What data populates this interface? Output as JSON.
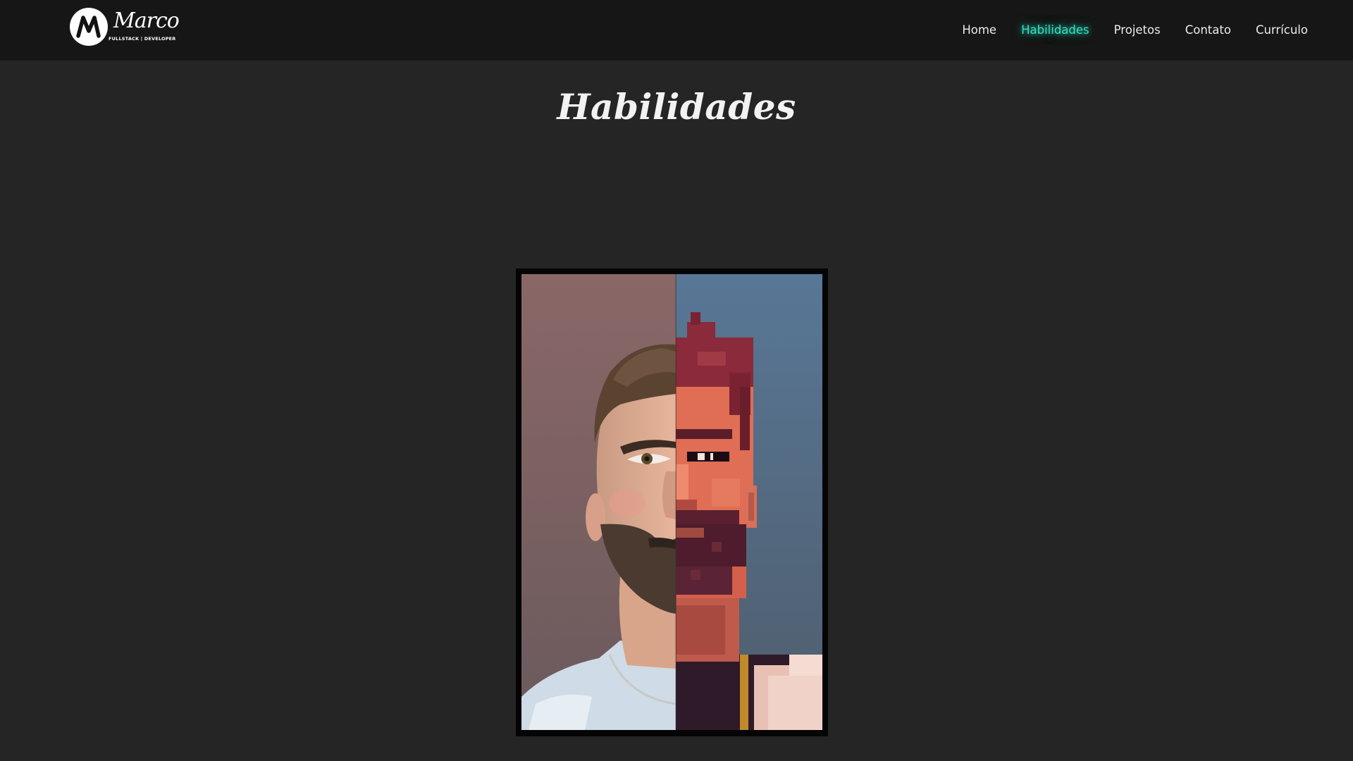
{
  "header": {
    "logo": {
      "monogram": "M",
      "name": "Marco",
      "tagline": "FULLSTACK | DEVELOPER"
    },
    "nav": [
      {
        "label": "Home",
        "active": false
      },
      {
        "label": "Habilidades",
        "active": true
      },
      {
        "label": "Projetos",
        "active": false
      },
      {
        "label": "Contato",
        "active": false
      },
      {
        "label": "Currículo",
        "active": false
      }
    ]
  },
  "main": {
    "title": "Habilidades"
  },
  "colors": {
    "background": "#252525",
    "header_background": "#161616",
    "accent": "#2ee6c4",
    "text": "#ececec"
  }
}
